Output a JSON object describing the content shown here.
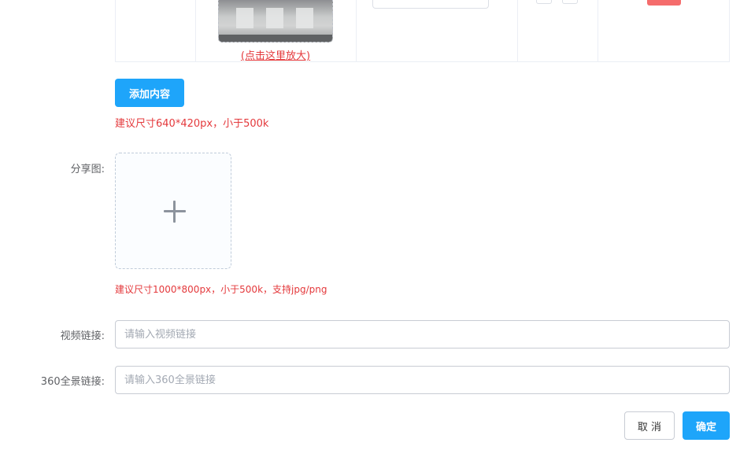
{
  "table": {
    "zoom_link": "(点击这里放大)"
  },
  "content": {
    "add_button": "添加内容",
    "size_tip": "建议尺寸640*420px，小于500k"
  },
  "share_image": {
    "label": "分享图:",
    "upload_icon": "plus-icon",
    "tip": "建议尺寸1000*800px，小于500k，支持jpg/png"
  },
  "video_link": {
    "label": "视频链接:",
    "value": "",
    "placeholder": "请输入视频链接"
  },
  "panorama_link": {
    "label": "360全景链接:",
    "value": "",
    "placeholder": "请输入360全景链接"
  },
  "footer": {
    "cancel_label": "取 消",
    "confirm_label": "确定"
  },
  "colors": {
    "primary": "#1ea5fa",
    "danger": "#f56c6c",
    "tip_red": "#e4393c"
  }
}
